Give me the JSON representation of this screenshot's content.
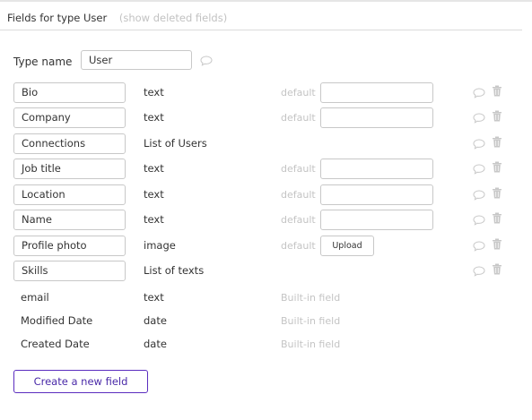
{
  "header": {
    "title": "Fields for type User",
    "show_deleted": "(show deleted fields)"
  },
  "type_name": {
    "label": "Type name",
    "value": "User"
  },
  "fields": [
    {
      "name": "Bio",
      "type": "text",
      "default_label": "default",
      "default_kind": "input"
    },
    {
      "name": "Company",
      "type": "text",
      "default_label": "default",
      "default_kind": "input"
    },
    {
      "name": "Connections",
      "type": "List of Users",
      "default_label": "",
      "default_kind": "none"
    },
    {
      "name": "Job title",
      "type": "text",
      "default_label": "default",
      "default_kind": "input"
    },
    {
      "name": "Location",
      "type": "text",
      "default_label": "default",
      "default_kind": "input"
    },
    {
      "name": "Name",
      "type": "text",
      "default_label": "default",
      "default_kind": "input"
    },
    {
      "name": "Profile photo",
      "type": "image",
      "default_label": "default",
      "default_kind": "upload",
      "upload_label": "Upload"
    },
    {
      "name": "Skills",
      "type": "List of texts",
      "default_label": "",
      "default_kind": "none"
    }
  ],
  "builtin_fields": [
    {
      "name": "email",
      "type": "text",
      "note": "Built-in field"
    },
    {
      "name": "Modified Date",
      "type": "date",
      "note": "Built-in field"
    },
    {
      "name": "Created Date",
      "type": "date",
      "note": "Built-in field"
    }
  ],
  "create_button": "Create a new field",
  "icons": {
    "comment": "speech-bubble-icon",
    "delete": "trash-icon"
  },
  "colors": {
    "accent": "#5b2dbf",
    "muted_text": "#c4c4c4",
    "border": "#c8c8c8"
  }
}
